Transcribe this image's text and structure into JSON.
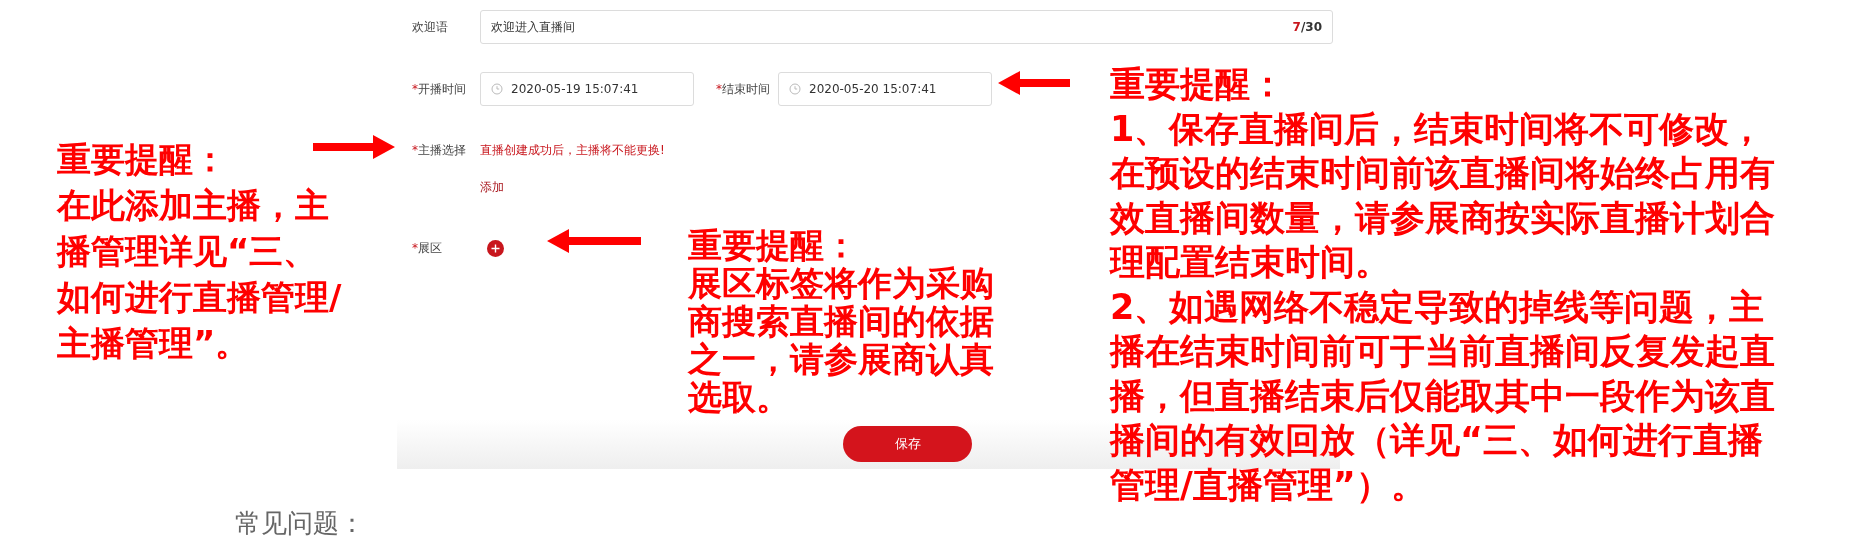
{
  "form": {
    "welcome": {
      "label": "欢迎语",
      "value": "欢迎进入直播间",
      "count": "7",
      "max": "/30"
    },
    "times": [
      {
        "required_mark": "*",
        "label": "开播时间",
        "value": "2020-05-19 15:07:41"
      },
      {
        "required_mark": "*",
        "label": "结束时间",
        "value": "2020-05-20 15:07:41"
      }
    ],
    "anchor": {
      "required_mark": "*",
      "label": "主播选择",
      "notice": "直播创建成功后，主播将不能更换!",
      "add_link": "添加"
    },
    "zone": {
      "required_mark": "*",
      "label": "展区"
    },
    "save_button": "保存"
  },
  "annotations": [
    {
      "kind": "left",
      "lines": [
        "重要提醒：",
        "在此添加主播，主",
        "播管理详见“三、",
        "如何进行直播管理/",
        "主播管理”。"
      ]
    },
    {
      "kind": "middle",
      "lines": [
        "重要提醒：",
        "展区标签将作为采购",
        "商搜索直播间的依据",
        "之一，请参展商认真",
        "选取。"
      ]
    },
    {
      "kind": "right",
      "lines": [
        "重要提醒：",
        "1、保存直播间后，结束时间将不可修改，",
        "在预设的结束时间前该直播间将始终占用有",
        "效直播间数量，请参展商按实际直播计划合",
        "理配置结束时间。",
        "2、如遇网络不稳定导致的掉线等问题，主",
        "播在结束时间前可于当前直播间反复发起直",
        "播，但直播结束后仅能取其中一段作为该直",
        "播间的有效回放（详见“三、如何进行直播",
        "管理/直播管理”）。"
      ]
    }
  ],
  "faq_heading": "常见问题："
}
